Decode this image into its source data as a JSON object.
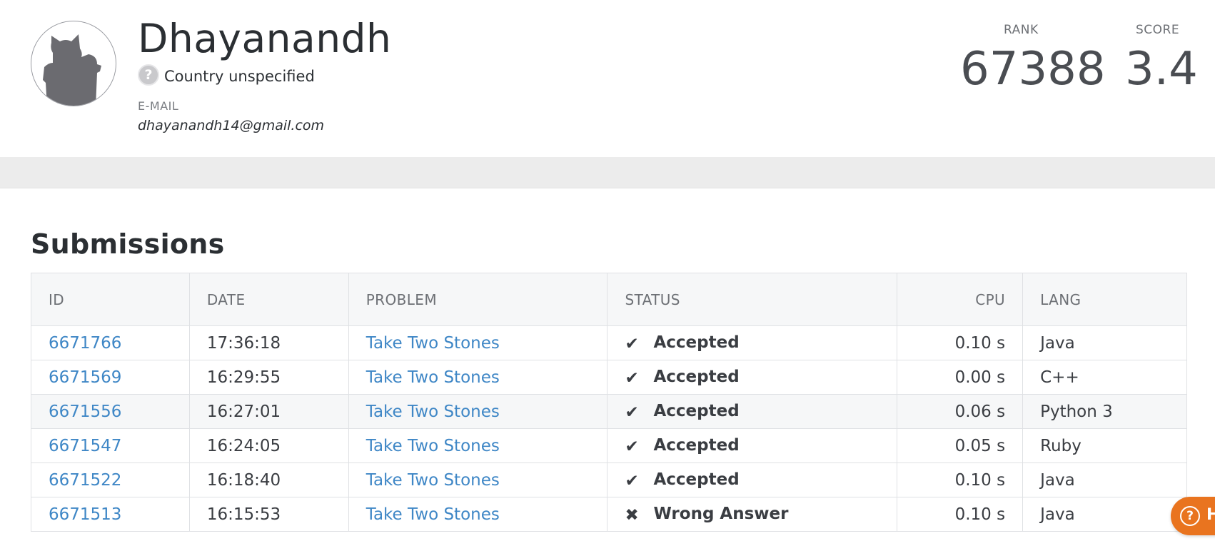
{
  "profile": {
    "name": "Dhayanandh",
    "country_flag_glyph": "?",
    "country": "Country unspecified",
    "email_label": "E-MAIL",
    "email": "dhayanandh14@gmail.com",
    "rank_label": "RANK",
    "rank": "67388",
    "score_label": "SCORE",
    "score": "3.4",
    "avatar_icon": "user-avatar-placeholder-icon"
  },
  "submissions": {
    "title": "Submissions",
    "columns": {
      "id": "ID",
      "date": "DATE",
      "problem": "PROBLEM",
      "status": "STATUS",
      "cpu": "CPU",
      "lang": "LANG"
    },
    "rows": [
      {
        "id": "6671766",
        "date": "17:36:18",
        "problem": "Take Two Stones",
        "status_glyph": "✔",
        "status": "Accepted",
        "cpu": "0.10 s",
        "lang": "Java"
      },
      {
        "id": "6671569",
        "date": "16:29:55",
        "problem": "Take Two Stones",
        "status_glyph": "✔",
        "status": "Accepted",
        "cpu": "0.00 s",
        "lang": "C++"
      },
      {
        "id": "6671556",
        "date": "16:27:01",
        "problem": "Take Two Stones",
        "status_glyph": "✔",
        "status": "Accepted",
        "cpu": "0.06 s",
        "lang": "Python 3"
      },
      {
        "id": "6671547",
        "date": "16:24:05",
        "problem": "Take Two Stones",
        "status_glyph": "✔",
        "status": "Accepted",
        "cpu": "0.05 s",
        "lang": "Ruby"
      },
      {
        "id": "6671522",
        "date": "16:18:40",
        "problem": "Take Two Stones",
        "status_glyph": "✔",
        "status": "Accepted",
        "cpu": "0.10 s",
        "lang": "Java"
      },
      {
        "id": "6671513",
        "date": "16:15:53",
        "problem": "Take Two Stones",
        "status_glyph": "✖",
        "status": "Wrong Answer",
        "cpu": "0.10 s",
        "lang": "Java"
      }
    ]
  },
  "help": {
    "glyph": "?",
    "label": "H"
  },
  "colors": {
    "accepted": "#2eb840",
    "wrong_answer": "#e61e1e",
    "link": "#3f87c6",
    "help_button": "#e9741f"
  }
}
